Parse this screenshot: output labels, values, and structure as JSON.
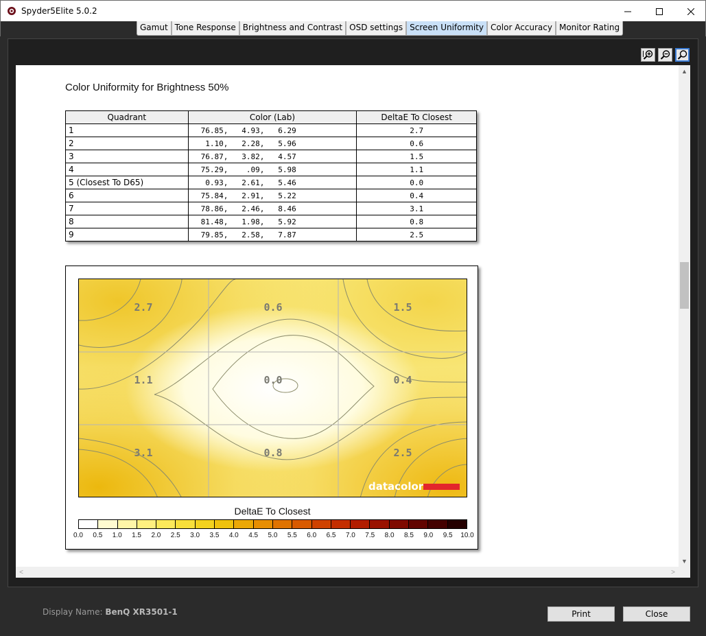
{
  "window": {
    "title": "Spyder5Elite 5.0.2"
  },
  "tabs": [
    {
      "label": "Gamut"
    },
    {
      "label": "Tone Response"
    },
    {
      "label": "Brightness and Contrast"
    },
    {
      "label": "OSD settings"
    },
    {
      "label": "Screen Uniformity",
      "active": true
    },
    {
      "label": "Color Accuracy"
    },
    {
      "label": "Monitor Rating"
    }
  ],
  "report": {
    "title": "Color Uniformity for Brightness 50%",
    "table": {
      "headers": [
        "Quadrant",
        "Color (Lab)",
        "DeltaE To Closest"
      ],
      "rows": [
        {
          "quadrant": "1",
          "lab": "76.85,   4.93,   6.29",
          "delta": "2.7"
        },
        {
          "quadrant": "2",
          "lab": " 1.10,   2.28,   5.96",
          "delta": "0.6"
        },
        {
          "quadrant": "3",
          "lab": "76.87,   3.82,   4.57",
          "delta": "1.5"
        },
        {
          "quadrant": "4",
          "lab": "75.29,    .09,   5.98",
          "delta": "1.1"
        },
        {
          "quadrant": "5 (Closest To D65)",
          "lab": " 0.93,   2.61,   5.46",
          "delta": "0.0"
        },
        {
          "quadrant": "6",
          "lab": "75.84,   2.91,   5.22",
          "delta": "0.4"
        },
        {
          "quadrant": "7",
          "lab": "78.86,   2.46,   8.46",
          "delta": "3.1"
        },
        {
          "quadrant": "8",
          "lab": "81.48,   1.98,   5.92",
          "delta": "0.8"
        },
        {
          "quadrant": "9",
          "lab": "79.85,   2.58,   7.87",
          "delta": "2.5"
        }
      ]
    },
    "heatmap": {
      "cell_values": [
        "2.7",
        "0.6",
        "1.5",
        "1.1",
        "0.0",
        "0.4",
        "3.1",
        "0.8",
        "2.5"
      ],
      "logo": "datacolor",
      "logo_bar_color": "#e3262b"
    },
    "colorbar": {
      "title": "DeltaE To Closest",
      "ticks": [
        "0.0",
        "0.5",
        "1.0",
        "1.5",
        "2.0",
        "2.5",
        "3.0",
        "3.5",
        "4.0",
        "4.5",
        "5.0",
        "5.5",
        "6.0",
        "6.5",
        "7.0",
        "7.5",
        "8.0",
        "8.5",
        "9.0",
        "9.5",
        "10.0"
      ],
      "colors": [
        "#ffffff",
        "#fffbd0",
        "#fff6a8",
        "#fff080",
        "#fce95a",
        "#f8df3a",
        "#f3d21e",
        "#efc20d",
        "#eba806",
        "#e78e02",
        "#e07300",
        "#d85a00",
        "#cf4200",
        "#c42e00",
        "#b21d00",
        "#9a1200",
        "#7f0a00",
        "#620400",
        "#440100",
        "#250000"
      ]
    }
  },
  "footer": {
    "display_name_label": "Display Name:",
    "display_name_value": "BenQ XR3501-1",
    "print_label": "Print",
    "close_label": "Close"
  }
}
